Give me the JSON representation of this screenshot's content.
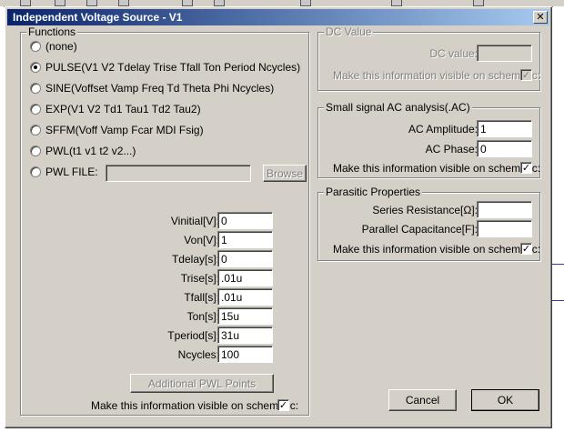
{
  "dialog": {
    "title": "Independent Voltage Source - V1",
    "close_glyph": "✕"
  },
  "functions": {
    "group_label": "Functions",
    "options": [
      {
        "label": "(none)",
        "selected": false
      },
      {
        "label": "PULSE(V1 V2 Tdelay Trise Tfall Ton Period Ncycles)",
        "selected": true
      },
      {
        "label": "SINE(Voffset Vamp Freq Td Theta Phi Ncycles)",
        "selected": false
      },
      {
        "label": "EXP(V1 V2 Td1 Tau1 Td2 Tau2)",
        "selected": false
      },
      {
        "label": "SFFM(Voff Vamp Fcar MDI Fsig)",
        "selected": false
      },
      {
        "label": "PWL(t1 v1 t2 v2...)",
        "selected": false
      },
      {
        "label": "PWL FILE:",
        "selected": false
      }
    ],
    "pwl_file_value": "",
    "browse_label": "Browse",
    "params": [
      {
        "label": "Vinitial[V]:",
        "value": "0"
      },
      {
        "label": "Von[V]:",
        "value": "1"
      },
      {
        "label": "Tdelay[s]:",
        "value": "0"
      },
      {
        "label": "Trise[s]:",
        "value": ".01u"
      },
      {
        "label": "Tfall[s]:",
        "value": ".01u"
      },
      {
        "label": "Ton[s]:",
        "value": "15u"
      },
      {
        "label": "Tperiod[s]:",
        "value": "31u"
      },
      {
        "label": "Ncycles:",
        "value": "100"
      }
    ],
    "additional_pwl_label": "Additional PWL Points",
    "visible_label": "Make this information visible on schematic:",
    "visible_checked": "✓"
  },
  "dc_value": {
    "group_label": "DC Value",
    "field_label": "DC value:",
    "field_value": "",
    "visible_label": "Make this information visible on schematic:",
    "visible_checked": "✓"
  },
  "ac": {
    "group_label": "Small signal AC analysis(.AC)",
    "amplitude_label": "AC Amplitude:",
    "amplitude_value": "1",
    "phase_label": "AC Phase:",
    "phase_value": "0",
    "visible_label": "Make this information visible on schematic:",
    "visible_checked": "✓"
  },
  "parasitic": {
    "group_label": "Parasitic Properties",
    "series_label": "Series Resistance[Ω]:",
    "series_value": "",
    "parallel_label": "Parallel Capacitance[F]:",
    "parallel_value": "",
    "visible_label": "Make this information visible on schematic:",
    "visible_checked": "✓"
  },
  "buttons": {
    "cancel": "Cancel",
    "ok": "OK"
  },
  "colors": {
    "titlebar_start": "#0a246a",
    "titlebar_end": "#a6caf0",
    "face": "#d4d0c8"
  }
}
